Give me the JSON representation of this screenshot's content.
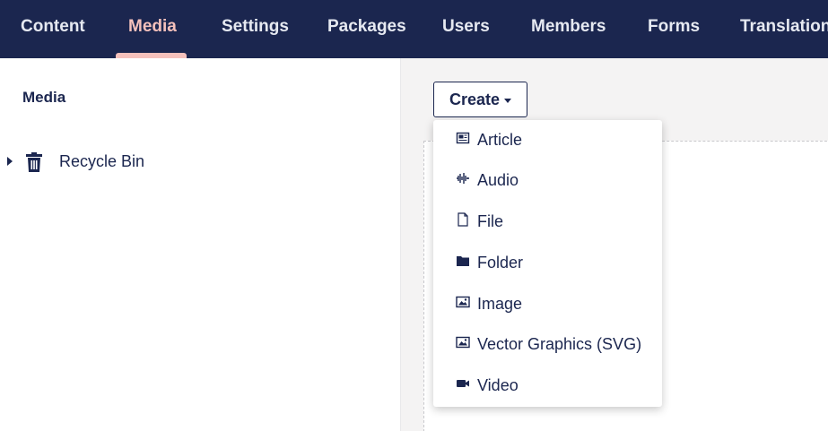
{
  "nav": {
    "tabs": [
      {
        "label": "Content"
      },
      {
        "label": "Media",
        "active": true
      },
      {
        "label": "Settings"
      },
      {
        "label": "Packages"
      },
      {
        "label": "Users"
      },
      {
        "label": "Members"
      },
      {
        "label": "Forms"
      },
      {
        "label": "Translation"
      }
    ]
  },
  "tree": {
    "title": "Media",
    "items": [
      {
        "label": "Recycle Bin",
        "icon": "trash-icon"
      }
    ]
  },
  "create": {
    "label": "Create",
    "menu": [
      {
        "label": "Article",
        "icon": "article-icon"
      },
      {
        "label": "Audio",
        "icon": "audio-icon"
      },
      {
        "label": "File",
        "icon": "file-icon"
      },
      {
        "label": "Folder",
        "icon": "folder-icon"
      },
      {
        "label": "Image",
        "icon": "image-icon"
      },
      {
        "label": "Vector Graphics (SVG)",
        "icon": "image-icon"
      },
      {
        "label": "Video",
        "icon": "video-icon"
      }
    ]
  },
  "colors": {
    "header_bg": "#1b264f",
    "accent": "#f5c1bc",
    "text": "#1b264f"
  }
}
